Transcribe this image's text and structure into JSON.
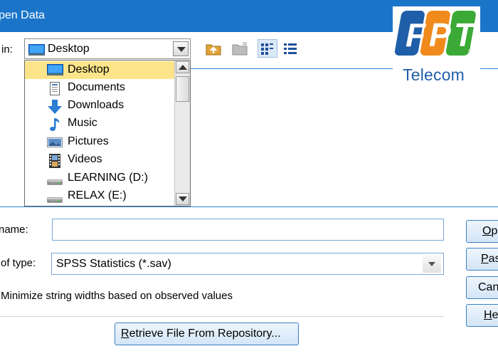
{
  "window": {
    "title": "pen Data"
  },
  "look_in": {
    "label": "in:",
    "value": "Desktop",
    "options": [
      {
        "label": "Desktop",
        "icon": "desktop-icon",
        "selected": true
      },
      {
        "label": "Documents",
        "icon": "documents-icon",
        "selected": false
      },
      {
        "label": "Downloads",
        "icon": "downloads-icon",
        "selected": false
      },
      {
        "label": "Music",
        "icon": "music-icon",
        "selected": false
      },
      {
        "label": "Pictures",
        "icon": "pictures-icon",
        "selected": false
      },
      {
        "label": "Videos",
        "icon": "videos-icon",
        "selected": false
      },
      {
        "label": "LEARNING (D:)",
        "icon": "drive-icon",
        "selected": false
      },
      {
        "label": "RELAX (E:)",
        "icon": "drive-icon",
        "selected": false
      }
    ]
  },
  "toolbar": {
    "icons": [
      "up-folder-icon",
      "new-folder-icon",
      "list-view-icon",
      "details-view-icon"
    ]
  },
  "form": {
    "file_name_label": "name:",
    "file_name_value": "",
    "file_type_label": "of type:",
    "file_type_value": "SPSS Statistics (*.sav)",
    "minimize_label": "Minimize string widths based on observed values",
    "retrieve_label": "Retrieve File From Repository..."
  },
  "buttons": {
    "open": "Op",
    "paste": "Pas",
    "cancel": "Can",
    "help": "He"
  },
  "logo": {
    "letters": [
      "F",
      "P",
      "T"
    ],
    "word": "Telecom",
    "registered": "®"
  },
  "colors": {
    "title_bar": "#1a75c9",
    "selection": "#fbe48a",
    "fpt_blue": "#1f5ea8",
    "fpt_orange": "#f08a1d",
    "fpt_green": "#3aa935"
  }
}
